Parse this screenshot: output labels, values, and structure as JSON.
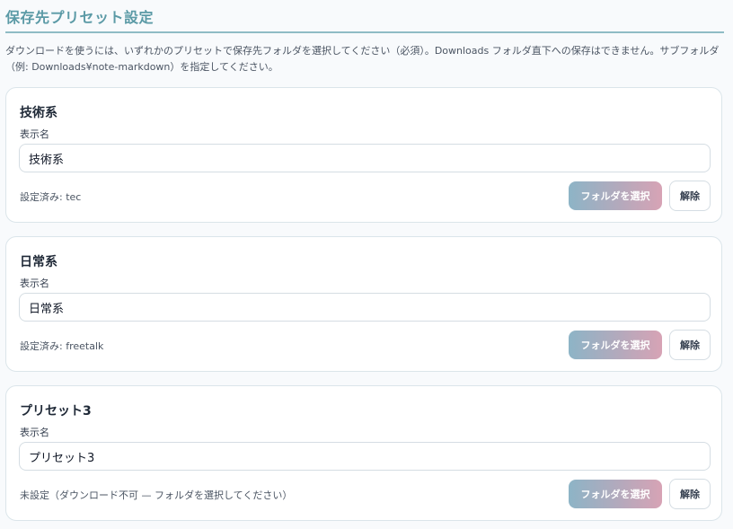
{
  "section": {
    "title": "保存先プリセット設定",
    "description": "ダウンロードを使うには、いずれかのプリセットで保存先フォルダを選択してください（必須）。Downloads フォルダ直下への保存はできません。サブフォルダ（例: Downloads¥note-markdown）を指定してください。"
  },
  "presets": [
    {
      "heading": "技術系",
      "field_label": "表示名",
      "display_name": "技術系",
      "status": "設定済み: tec",
      "select_folder_label": "フォルダを選択",
      "clear_label": "解除"
    },
    {
      "heading": "日常系",
      "field_label": "表示名",
      "display_name": "日常系",
      "status": "設定済み: freetalk",
      "select_folder_label": "フォルダを選択",
      "clear_label": "解除"
    },
    {
      "heading": "プリセット3",
      "field_label": "表示名",
      "display_name": "プリセット3",
      "status": "未設定（ダウンロード不可 — フォルダを選択してください）",
      "select_folder_label": "フォルダを選択",
      "clear_label": "解除"
    }
  ]
}
